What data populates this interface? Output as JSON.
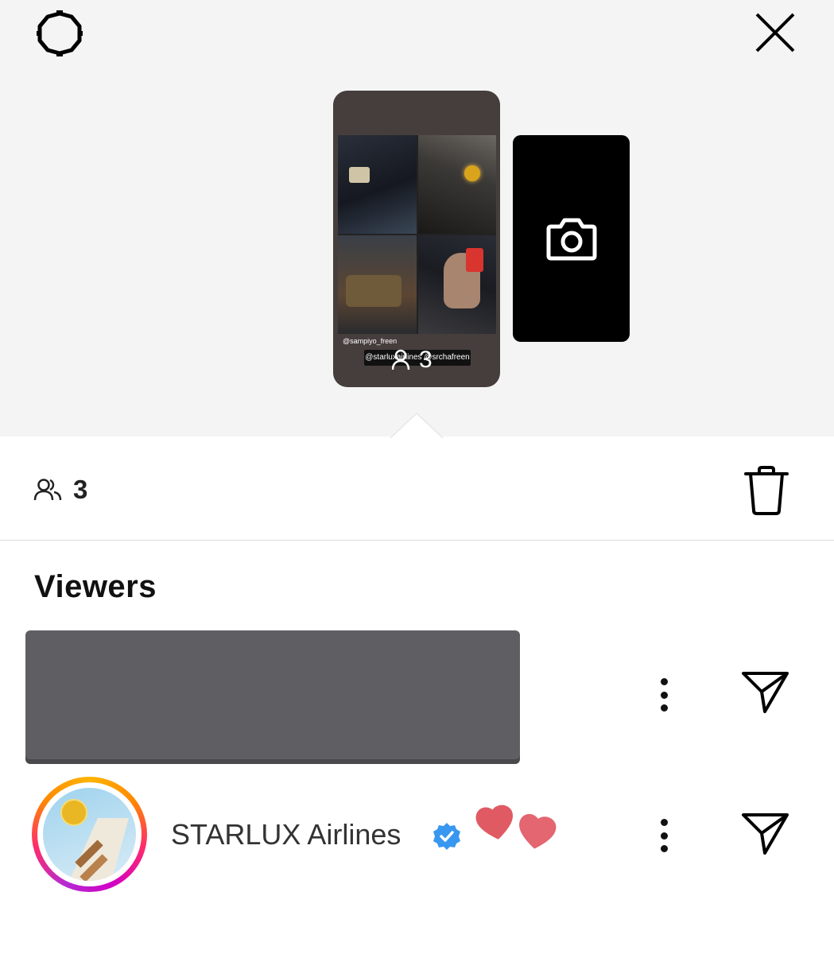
{
  "story": {
    "mention_top": "@sampiyo_freen",
    "mention_tags": "@starluxairlines @srchafreen",
    "overlay_count": "3"
  },
  "stats": {
    "viewer_count": "3"
  },
  "viewers": {
    "title": "Viewers",
    "items": [
      {
        "name": "[redacted]",
        "redacted": true
      },
      {
        "name": "STARLUX Airlines",
        "verified": true,
        "reaction": "hearts"
      }
    ]
  },
  "icons": [
    "gear-icon",
    "close-icon",
    "camera-icon",
    "people-icon",
    "trash-icon",
    "more-icon",
    "send-icon",
    "verified-icon",
    "heart-icon"
  ],
  "colors": {
    "top_background": "#f4f4f4",
    "story_background": "#463e3d",
    "verified_blue": "#3897f0",
    "heart": "#e05a63",
    "redaction": "#5f5f63"
  }
}
